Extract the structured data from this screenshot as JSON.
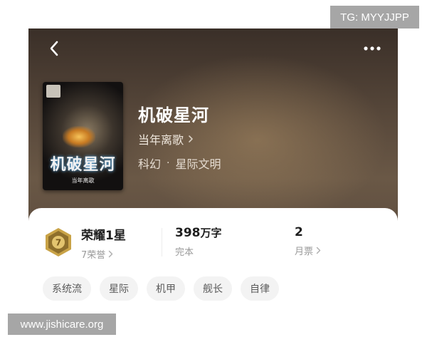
{
  "header": {
    "back_icon": "chevron-left-icon",
    "more_icon": "more-horizontal-icon"
  },
  "book": {
    "title": "机破星河",
    "author": "当年离歌",
    "genre": "科幻",
    "subgenre": "星际文明",
    "cover": {
      "title": "机破星河",
      "author": "当年离歌"
    }
  },
  "stats": {
    "honor": {
      "title": "荣耀1星",
      "sub": "7荣誉",
      "badge_number": "7"
    },
    "words": {
      "value": "398",
      "unit": "万字",
      "sub": "完本"
    },
    "votes": {
      "value": "2",
      "sub": "月票"
    }
  },
  "tags": [
    "系统流",
    "星际",
    "机甲",
    "舰长",
    "自律"
  ],
  "watermarks": {
    "top_right": "TG: MYYJJPP",
    "bottom_left": "www.jishicare.org"
  },
  "colors": {
    "hero_dark": "#3a2f28",
    "hero_light": "#6a5846",
    "badge_gold": "#c9a347",
    "tag_bg": "#f3f3f3"
  }
}
